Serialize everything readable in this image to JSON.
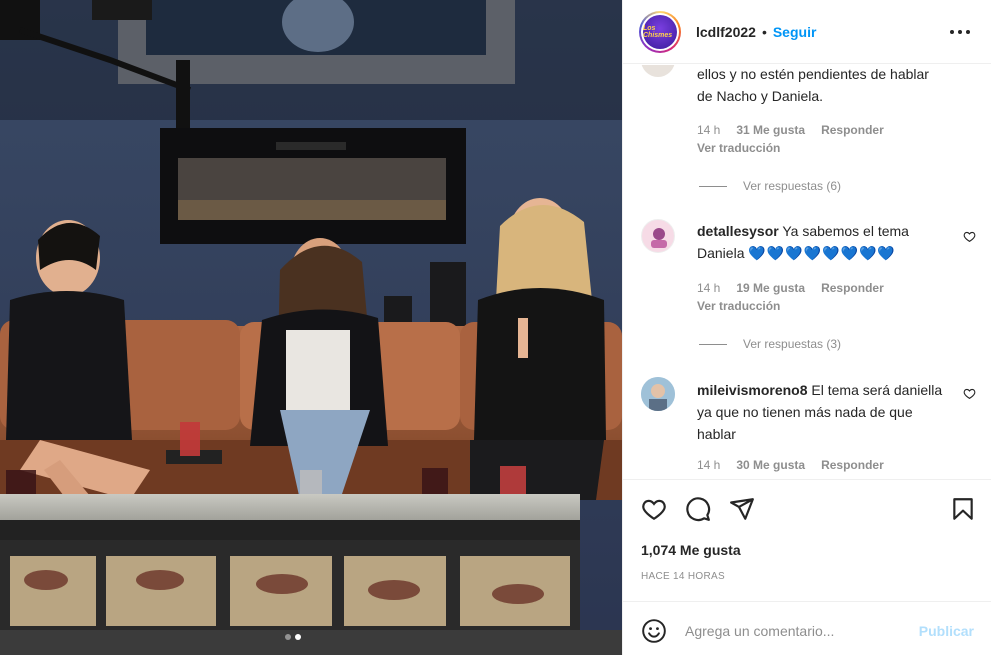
{
  "header": {
    "avatar_text": "Los Chismes",
    "username": "lcdlf2022",
    "separator": "•",
    "follow_label": "Seguir"
  },
  "comments": [
    {
      "text": "ellos y no estén pendientes de hablar de Nacho y Daniela.",
      "time": "14 h",
      "likes": "31 Me gusta",
      "reply": "Responder",
      "translate": "Ver traducción",
      "view_replies": "Ver respuestas (6)"
    },
    {
      "username": "detallesysor",
      "text": " Ya sabemos el tema Daniela ",
      "hearts": "💙💙💙💙💙💙💙💙",
      "time": "14 h",
      "likes": "19 Me gusta",
      "reply": "Responder",
      "translate": "Ver traducción",
      "view_replies": "Ver respuestas (3)"
    },
    {
      "username": "mileivismoreno8",
      "text": " El tema será daniella ya que no tienen más nada de que hablar",
      "time": "14 h",
      "likes": "30 Me gusta",
      "reply": "Responder"
    }
  ],
  "actions": {
    "likes_total": "1,074 Me gusta",
    "time_ago": "HACE 14 HORAS"
  },
  "composer": {
    "placeholder": "Agrega un comentario...",
    "publish_label": "Publicar"
  },
  "carousel": {
    "count": 2,
    "active": 2
  },
  "colors": {
    "accent": "#0095f6",
    "publish_disabled": "#b2dffc",
    "muted": "#8e8e8e",
    "heart_blue": "#0a6fd6"
  }
}
